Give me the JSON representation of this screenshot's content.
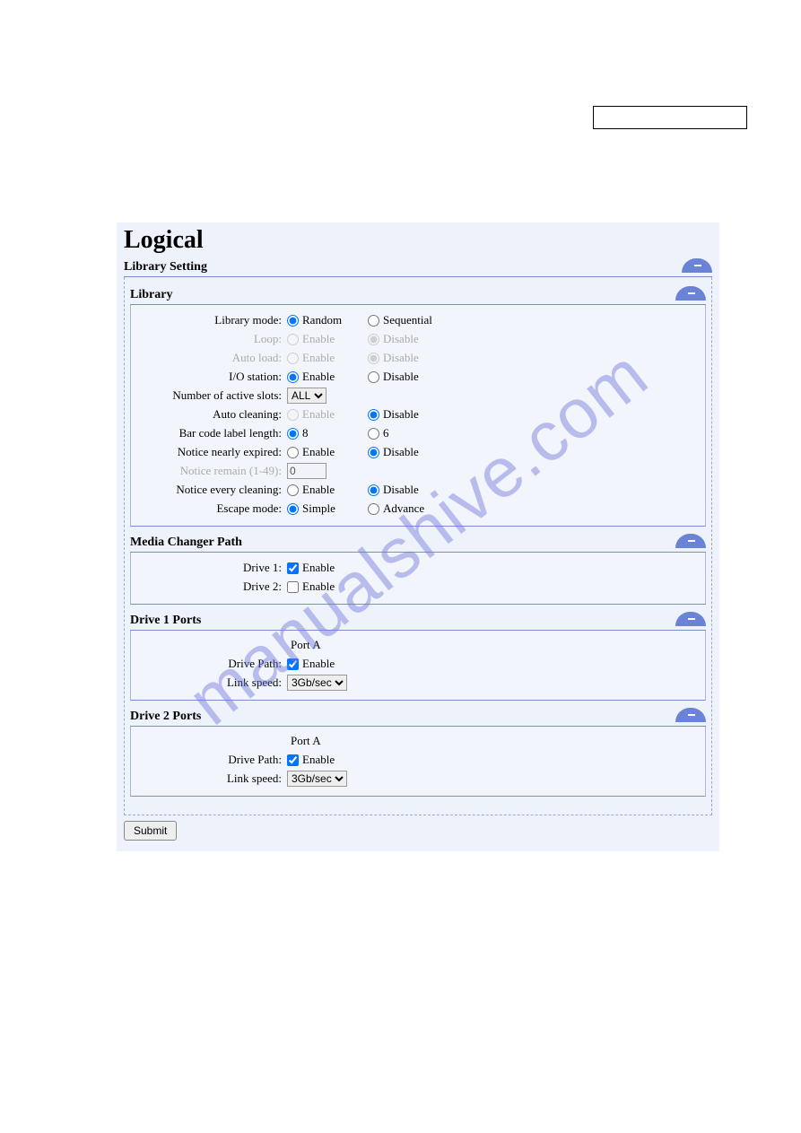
{
  "watermark": "manualshive.com",
  "page_title": "Logical",
  "section_title": "Library Setting",
  "library": {
    "title": "Library",
    "mode": {
      "label": "Library mode:",
      "opt1": "Random",
      "opt2": "Sequential"
    },
    "loop": {
      "label": "Loop:",
      "opt1": "Enable",
      "opt2": "Disable"
    },
    "autoload": {
      "label": "Auto load:",
      "opt1": "Enable",
      "opt2": "Disable"
    },
    "io": {
      "label": "I/O station:",
      "opt1": "Enable",
      "opt2": "Disable"
    },
    "slots": {
      "label": "Number of active slots:",
      "value": "ALL"
    },
    "autoclean": {
      "label": "Auto cleaning:",
      "opt1": "Enable",
      "opt2": "Disable"
    },
    "barcode": {
      "label": "Bar code label length:",
      "opt1": "8",
      "opt2": "6"
    },
    "notice_exp": {
      "label": "Notice nearly expired:",
      "opt1": "Enable",
      "opt2": "Disable"
    },
    "remain": {
      "label": "Notice remain (1-49):",
      "value": "0"
    },
    "every_clean": {
      "label": "Notice every cleaning:",
      "opt1": "Enable",
      "opt2": "Disable"
    },
    "escape": {
      "label": "Escape mode:",
      "opt1": "Simple",
      "opt2": "Advance"
    }
  },
  "mcp": {
    "title": "Media Changer Path",
    "drive1": {
      "label": "Drive 1:",
      "opt": "Enable"
    },
    "drive2": {
      "label": "Drive 2:",
      "opt": "Enable"
    }
  },
  "d1": {
    "title": "Drive 1 Ports",
    "port": "Port A",
    "path": {
      "label": "Drive Path:",
      "opt": "Enable"
    },
    "speed": {
      "label": "Link speed:",
      "value": "3Gb/sec"
    }
  },
  "d2": {
    "title": "Drive 2 Ports",
    "port": "Port A",
    "path": {
      "label": "Drive Path:",
      "opt": "Enable"
    },
    "speed": {
      "label": "Link speed:",
      "value": "3Gb/sec"
    }
  },
  "submit": "Submit"
}
